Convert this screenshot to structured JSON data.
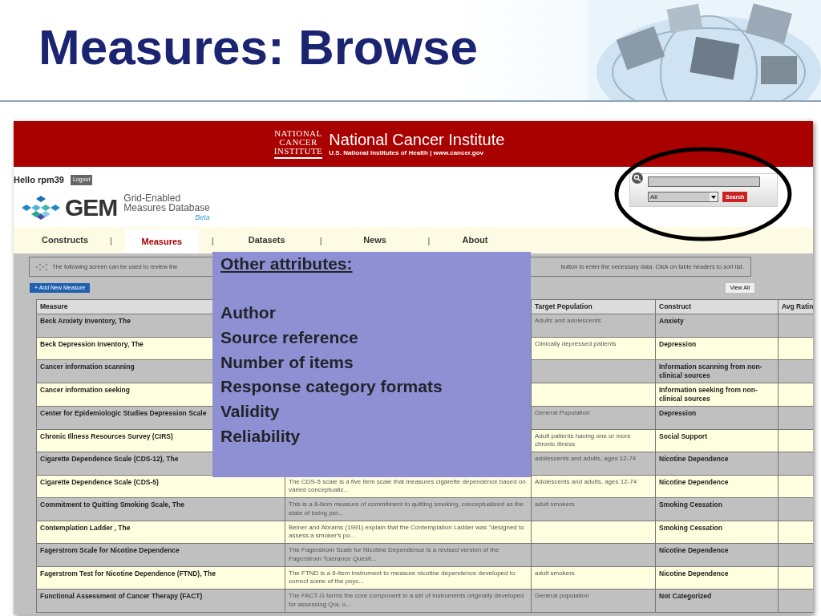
{
  "slide": {
    "title": "Measures: Browse"
  },
  "site": {
    "header": {
      "logo_lines": [
        "NATIONAL",
        "CANCER",
        "INSTITUTE"
      ],
      "title": "National Cancer Institute",
      "subtitle": "U.S. National Institutes of Health | www.cancer.gov"
    },
    "user": {
      "greeting": "Hello rpm39",
      "logout": "Logout"
    },
    "gem": {
      "wordmark": "GEM",
      "line1": "Grid-Enabled",
      "line2": "Measures Database",
      "beta": "Beta"
    },
    "search": {
      "scope": "All",
      "button": "Search"
    },
    "nav": [
      {
        "label": "Constructs",
        "selected": false
      },
      {
        "label": "Measures",
        "selected": true
      },
      {
        "label": "Datasets",
        "selected": false
      },
      {
        "label": "News",
        "selected": false
      },
      {
        "label": "About",
        "selected": false
      }
    ],
    "nav_separators": [
      "|",
      "|",
      "|",
      "|"
    ],
    "info": [
      "The following screen can be used to review the",
      "button to enter the necessary data. Click on table headers to sort list."
    ],
    "add_icon": "+",
    "add_button": "Add New Measure",
    "view_all": "View All",
    "table": {
      "columns": [
        "Measure",
        null,
        "Target Population",
        "Construct",
        "Avg Ratin"
      ],
      "rows": [
        {
          "measure": "Beck Anxiety Inventory, The",
          "population": "Adults and adolescents",
          "construct": "Anxiety"
        },
        {
          "measure": "Beck Depression Inventory, The",
          "population": "Clinically depressed patients",
          "construct": "Depression"
        },
        {
          "measure": "Cancer information scanning",
          "construct": "Information scanning from non-clinical sources"
        },
        {
          "measure": "Cancer information seeking",
          "construct": "Information seeking from non-clinical sources"
        },
        {
          "measure": "Center for Epidemiologic Studies Depression Scale",
          "population": "General Population",
          "construct": "Depression"
        },
        {
          "measure": "Chronic Illness Resources Survey (CIRS)",
          "population": "Adult patients having one or more chronic illness",
          "construct": "Social Support"
        },
        {
          "measure": "Cigarette Dependence Scale (CDS-12), The",
          "population": "adolescents and adults, ages 12-74",
          "construct": "Nicotine Dependence"
        },
        {
          "measure": "Cigarette Dependence Scale (CDS-5)",
          "description": "The CDS-5 scale is a five item scale that measures cigarette dependence based on varied conceptualiz...",
          "population": "Adolescents and adults, ages 12-74",
          "construct": "Nicotine Dependence"
        },
        {
          "measure": "Commitment to Quitting Smoking Scale, The",
          "description": "This is a 8-item measure of commitment to quitting smoking, conceptualized as the state of being per...",
          "population": "adult smokers",
          "construct": "Smoking Cessation"
        },
        {
          "measure": "Contemplation Ladder , The",
          "description": "Beiner and Abrams (1991) explain that the Contemplation Ladder was \"designed to assess a smoker's po...",
          "construct": "Smoking Cessation"
        },
        {
          "measure": "Fagerstrom Scale for Nicotine Dependence",
          "description": "The Fagerstrom Scale for Nicotine Dependence is a revised version of the Fagerstrom Tolerance Questi...",
          "construct": "Nicotine Dependence"
        },
        {
          "measure": "Fagerstrom Test for Nicotine Dependence (FTND), The",
          "description": "The FTND is a 6-item instrument to measure nicotine dependence developed to correct some of the psyc...",
          "population": "adult smokers",
          "construct": "Nicotine Dependence"
        },
        {
          "measure": "Functional Assessment of Cancer Therapy (FACT)",
          "description": "The FACT-G forms the core component in a set of instruments originally developed for assessing QoL o...",
          "population": "General population",
          "construct": "Not Categorized"
        }
      ]
    }
  },
  "overlay": {
    "heading": "Other attributes:",
    "items": [
      "Author",
      "Source reference",
      "Number of items",
      "Response category formats",
      "Validity",
      "Reliability"
    ]
  }
}
